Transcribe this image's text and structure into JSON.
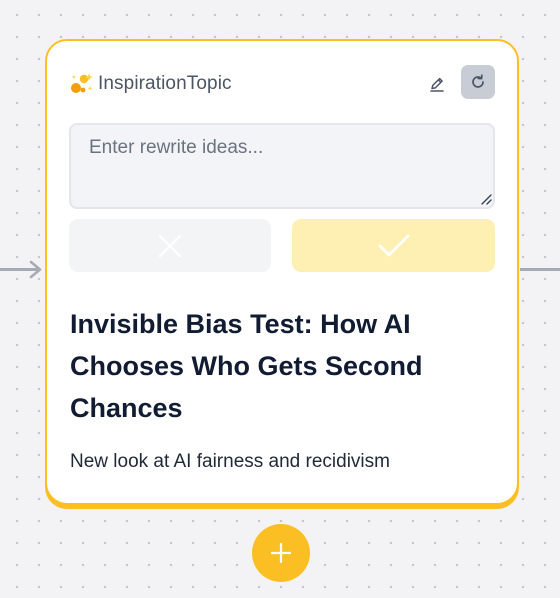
{
  "node": {
    "title": "InspirationTopic",
    "icons": {
      "title": "sparkle-icon",
      "edit": "pencil-icon",
      "refresh": "refresh-icon"
    },
    "rewrite_input": {
      "placeholder": "Enter rewrite ideas...",
      "value": ""
    },
    "cancel_icon": "close-icon",
    "confirm_icon": "check-icon",
    "topic_title": "Invisible Bias Test: How AI Chooses Who Gets Second Chances",
    "topic_subtitle": "New look at AI fairness and recidivism"
  },
  "canvas": {
    "add_icon": "plus-icon"
  },
  "colors": {
    "accent": "#fbbf24",
    "confirm_bg": "#fef0b3",
    "cancel_bg": "#f3f4f6",
    "refresh_bg": "#c8ccd5",
    "title_text": "#111c33"
  }
}
